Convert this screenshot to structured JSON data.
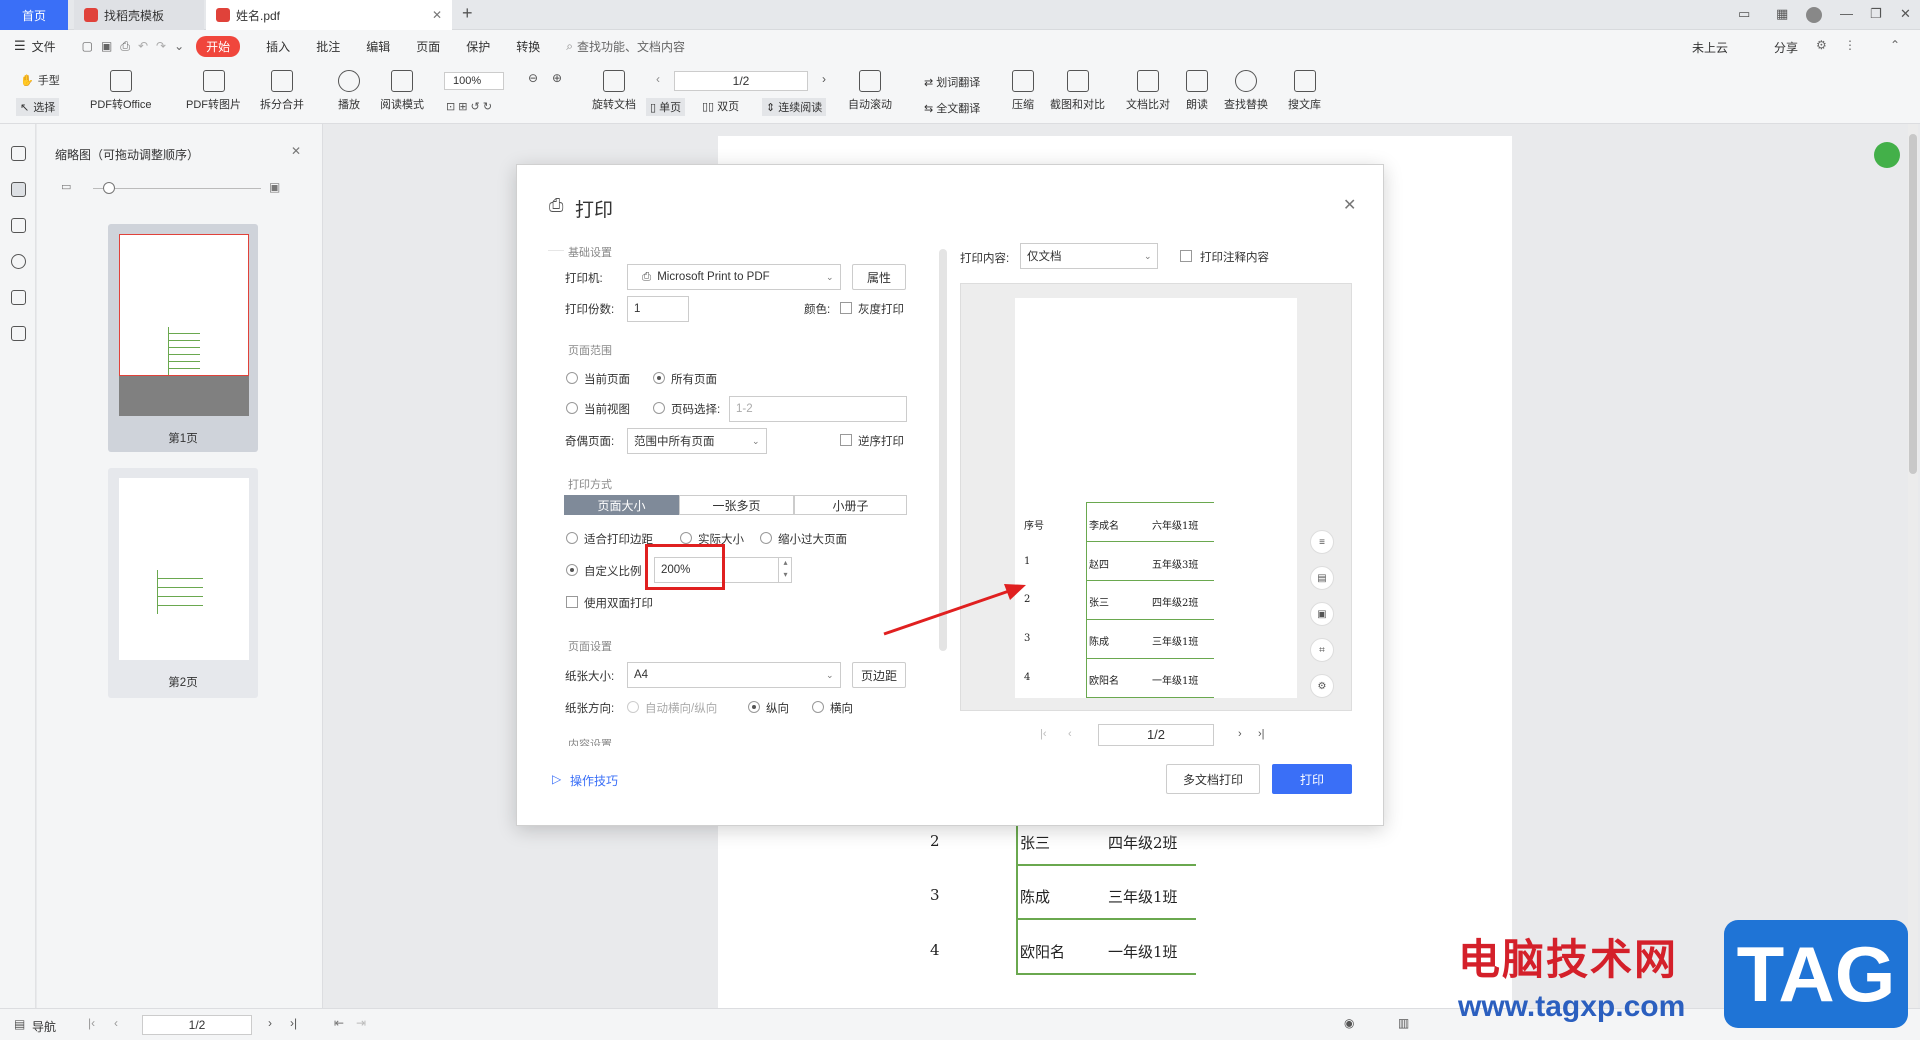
{
  "titlebar": {
    "home_tab": "首页",
    "tabs": [
      {
        "label": "找稻壳模板"
      },
      {
        "label": "姓名.pdf"
      }
    ],
    "add_tab": "+"
  },
  "menubar": {
    "items": [
      "文件",
      "开始",
      "插入",
      "批注",
      "编辑",
      "页面",
      "保护",
      "转换"
    ],
    "search_placeholder": "查找功能、文档内容",
    "right": {
      "cloud": "未上云",
      "share": "分享"
    }
  },
  "toolbar": {
    "hand": "手型",
    "select": "选择",
    "pdf_to_office": "PDF转Office",
    "pdf_to_image": "PDF转图片",
    "split_merge": "拆分合并",
    "play": "播放",
    "read_mode": "阅读模式",
    "zoom": "100%",
    "rotate": "旋转文档",
    "page_indicator": "1/2",
    "single": "单页",
    "double": "双页",
    "continuous": "连续阅读",
    "auto_scroll": "自动滚动",
    "word_translate": "划词翻译",
    "full_translate": "全文翻译",
    "compress": "压缩",
    "screenshot": "截图和对比",
    "compare": "文档比对",
    "read_aloud": "朗读",
    "find_replace": "查找替换",
    "library": "搜文库"
  },
  "thumbs": {
    "title": "缩略图（可拖动调整顺序）",
    "pages": [
      {
        "label": "第1页"
      },
      {
        "label": "第2页"
      }
    ]
  },
  "status": {
    "nav": "导航",
    "page": "1/2"
  },
  "doc_behind": {
    "rows": [
      {
        "no": "2",
        "name": "张三",
        "class": "四年级2班"
      },
      {
        "no": "3",
        "name": "陈成",
        "class": "三年级1班"
      },
      {
        "no": "4",
        "name": "欧阳名",
        "class": "一年级1班"
      }
    ]
  },
  "dialog": {
    "title": "打印",
    "basic_group": "基础设置",
    "printer_label": "打印机:",
    "printer_value": "Microsoft Print to PDF",
    "properties_button": "属性",
    "copies_label": "打印份数:",
    "copies_value": "1",
    "color_label": "颜色:",
    "grayscale_label": "灰度打印",
    "range_group": "页面范围",
    "current_page": "当前页面",
    "all_pages": "所有页面",
    "current_view": "当前视图",
    "page_select": "页码选择:",
    "page_select_placeholder": "1-2",
    "odd_even_label": "奇偶页面:",
    "odd_even_value": "范围中所有页面",
    "reverse_label": "逆序打印",
    "method_group": "打印方式",
    "method_tabs": [
      "页面大小",
      "一张多页",
      "小册子"
    ],
    "fit_margin": "适合打印边距",
    "actual_size": "实际大小",
    "shrink": "缩小过大页面",
    "custom_scale": "自定义比例",
    "custom_scale_value": "200%",
    "duplex": "使用双面打印",
    "page_group": "页面设置",
    "paper_label": "纸张大小:",
    "paper_value": "A4",
    "margins_button": "页边距",
    "orientation_label": "纸张方向:",
    "auto_orient": "自动横向/纵向",
    "portrait": "纵向",
    "landscape": "横向",
    "content_group": "内容设置",
    "tips_link": "操作技巧",
    "print_content_label": "打印内容:",
    "print_content_value": "仅文档",
    "print_annotations": "打印注释内容",
    "preview_page": "1/2",
    "multi_doc_button": "多文档打印",
    "print_button": "打印",
    "preview": {
      "header": {
        "no": "序号",
        "name": "李成名",
        "class": "六年级1班"
      },
      "rows": [
        {
          "no": "1",
          "name": "赵四",
          "class": "五年级3班"
        },
        {
          "no": "2",
          "name": "张三",
          "class": "四年级2班"
        },
        {
          "no": "3",
          "name": "陈成",
          "class": "三年级1班"
        },
        {
          "no": "4",
          "name": "欧阳名",
          "class": "一年级1班"
        }
      ]
    }
  },
  "watermark": {
    "cn": "电脑技术网",
    "url": "www.tagxp.com",
    "tag": "TAG"
  },
  "colors": {
    "accent": "#3a6ff7",
    "highlight_red": "#e02020",
    "table_green": "#6aa84f"
  }
}
